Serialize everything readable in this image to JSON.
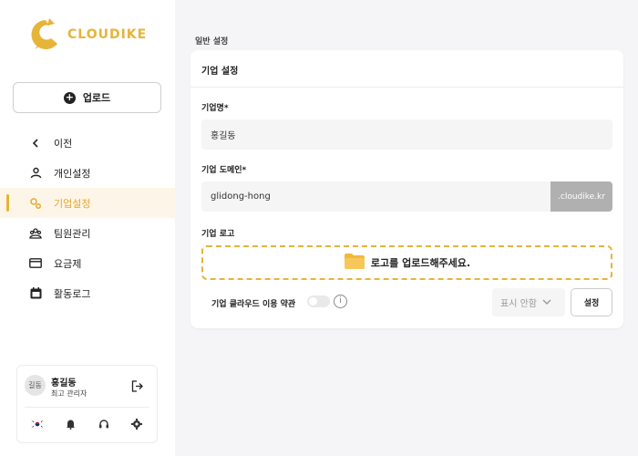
{
  "brand": {
    "name": "CLOUDIKE",
    "accent": "#e7b43a"
  },
  "sidebar": {
    "upload_label": "업로드",
    "items": [
      {
        "label": "이전",
        "icon": "chevron-left-icon"
      },
      {
        "label": "개인설정",
        "icon": "user-icon"
      },
      {
        "label": "기업설정",
        "icon": "gears-icon",
        "active": true
      },
      {
        "label": "팀원관리",
        "icon": "team-icon"
      },
      {
        "label": "요금제",
        "icon": "card-icon"
      },
      {
        "label": "활동로그",
        "icon": "calendar-icon"
      }
    ]
  },
  "user": {
    "avatar_text": "길동",
    "name": "홍길동",
    "role": "최고 관리자"
  },
  "main": {
    "section_title": "일반 설정",
    "panel_title": "기업 설정",
    "company_name_label": "기업명*",
    "company_name_value": "홍길동",
    "domain_label": "기업 도메인*",
    "domain_value": "glidong-hong",
    "domain_suffix": ".cloudike.kr",
    "logo_label": "기업 로고",
    "logo_upload_text": "로고를 업로드해주세요.",
    "terms_label": "기업 클라우드 이용 약관",
    "select_value": "표시 안함",
    "setting_button": "설정"
  }
}
